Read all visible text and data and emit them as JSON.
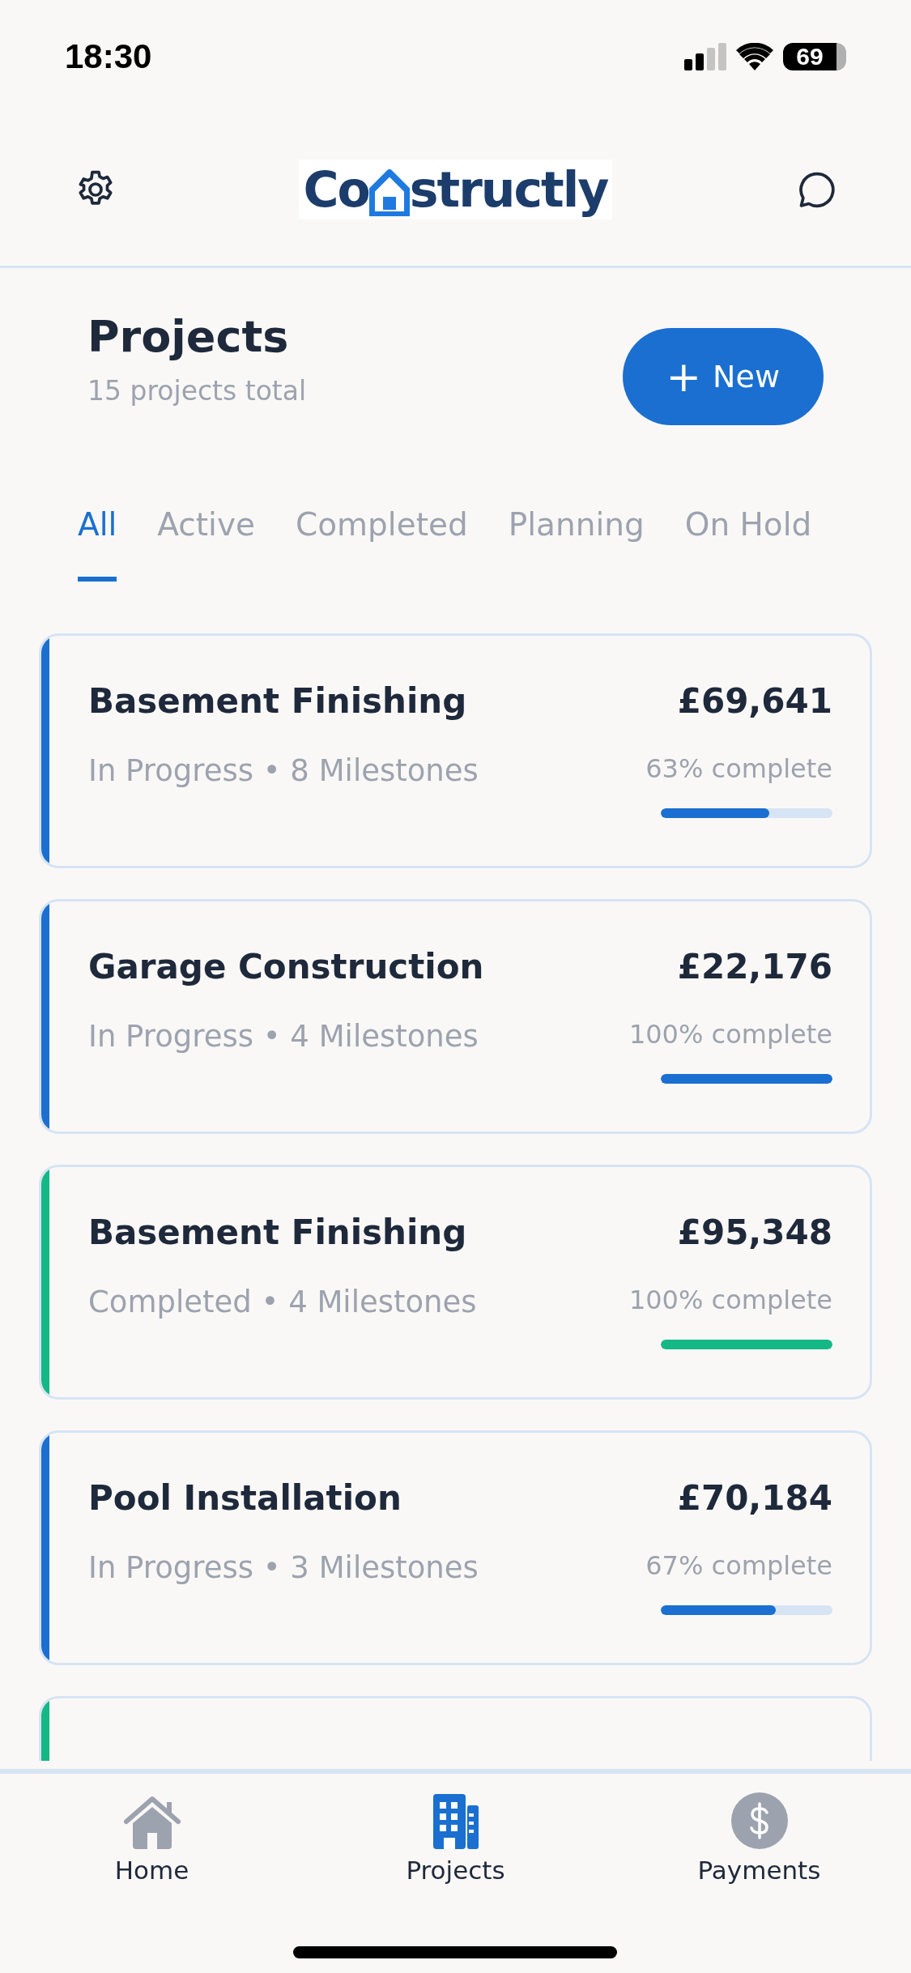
{
  "status_bar": {
    "time": "18:30",
    "battery": "69"
  },
  "header": {
    "logo_start": "Co",
    "logo_end": "structly"
  },
  "title": "Projects",
  "subtitle": "15 projects total",
  "new_button": {
    "icon": "+",
    "label": "New"
  },
  "tabs": [
    {
      "label": "All",
      "selected": true
    },
    {
      "label": "Active",
      "selected": false
    },
    {
      "label": "Completed",
      "selected": false
    },
    {
      "label": "Planning",
      "selected": false
    },
    {
      "label": "On Hold",
      "selected": false
    }
  ],
  "projects": [
    {
      "name": "Basement Finishing",
      "amount": "£69,641",
      "meta": "In Progress • 8 Milestones",
      "progress": "63% complete",
      "level": 0.63,
      "color": "#1a6fd1"
    },
    {
      "name": "Garage Construction",
      "amount": "£22,176",
      "meta": "In Progress • 4 Milestones",
      "progress": "100% complete",
      "level": 1,
      "color": "#1a6fd1"
    },
    {
      "name": "Basement Finishing",
      "amount": "£95,348",
      "meta": "Completed • 4 Milestones",
      "progress": "100% complete",
      "level": 1,
      "color": "#14b884"
    },
    {
      "name": "Pool Installation",
      "amount": "£70,184",
      "meta": "In Progress • 3 Milestones",
      "progress": "67% complete",
      "level": 0.67,
      "color": "#1a6fd1"
    },
    {
      "color": "#14b884"
    }
  ],
  "nav": [
    {
      "label": "Home",
      "kind": "home",
      "selected": false
    },
    {
      "label": "Projects",
      "kind": "projects",
      "selected": true
    },
    {
      "label": "Payments",
      "kind": "payments",
      "selected": false
    }
  ]
}
